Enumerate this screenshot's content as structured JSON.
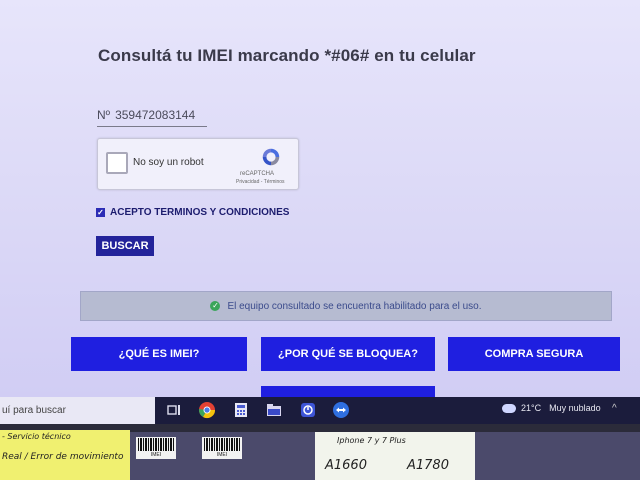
{
  "page": {
    "title": "Consultá tu IMEI marcando *#06# en tu celular",
    "imei_prefix": "Nº",
    "imei_value": "359472083144"
  },
  "recaptcha": {
    "label": "No soy un robot",
    "brand": "reCAPTCHA",
    "links": "Privacidad - Términos"
  },
  "terms": {
    "label": "ACEPTO TERMINOS Y CONDICIONES",
    "checked": true
  },
  "buttons": {
    "search": "BUSCAR"
  },
  "alert": {
    "message": "El equipo consultado se encuentra habilitado para el uso."
  },
  "nav": {
    "items": [
      "¿QUÉ ES IMEI?",
      "¿POR QUÉ SE BLOQUEA?",
      "COMPRA SEGURA"
    ]
  },
  "taskbar": {
    "search_placeholder": "uí para buscar",
    "temperature": "21°C",
    "weather": "Muy nublado",
    "icons": [
      "task-view-icon",
      "chrome-icon",
      "calculator-icon",
      "file-explorer-icon",
      "app-icon",
      "teamviewer-icon"
    ]
  },
  "desk": {
    "note1_line1": "- Servicio técnico",
    "note1_line2": "Real / Error de movimiento",
    "barcode1": "IMEI",
    "barcode2": "IMEI",
    "note2_line1": "Iphone 7 y 7 Plus",
    "note2_line2": "A1660",
    "note2_line3": "A1780"
  },
  "colors": {
    "accent": "#1f1fe0",
    "button_dark": "#23239a",
    "alert_bg": "#b6bbd1",
    "success": "#3aa55a"
  }
}
